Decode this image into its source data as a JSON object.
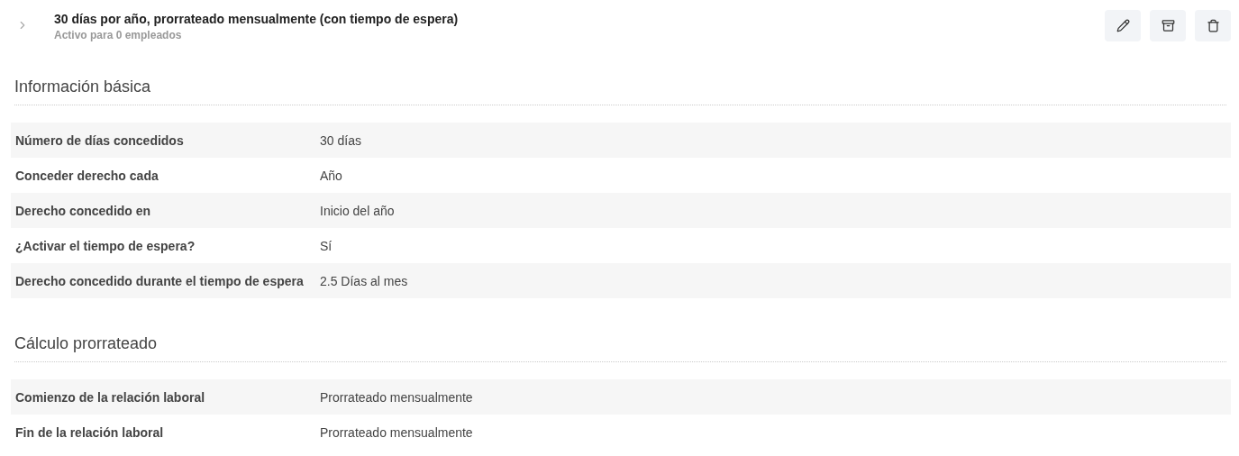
{
  "header": {
    "title": "30 días por año, prorrateado mensualmente (con tiempo de espera)",
    "subtitle": "Activo para 0 empleados",
    "expanded": false
  },
  "sections": [
    {
      "title": "Información básica",
      "rows": [
        {
          "label": "Número de días concedidos",
          "value": "30 días"
        },
        {
          "label": "Conceder derecho cada",
          "value": "Año"
        },
        {
          "label": "Derecho concedido en",
          "value": "Inicio del año"
        },
        {
          "label": "¿Activar el tiempo de espera?",
          "value": "Sí"
        },
        {
          "label": "Derecho concedido durante el tiempo de espera",
          "value": "2.5 Días al mes"
        }
      ]
    },
    {
      "title": "Cálculo prorrateado",
      "rows": [
        {
          "label": "Comienzo de la relación laboral",
          "value": "Prorrateado mensualmente"
        },
        {
          "label": "Fin de la relación laboral",
          "value": "Prorrateado mensualmente"
        }
      ]
    }
  ]
}
